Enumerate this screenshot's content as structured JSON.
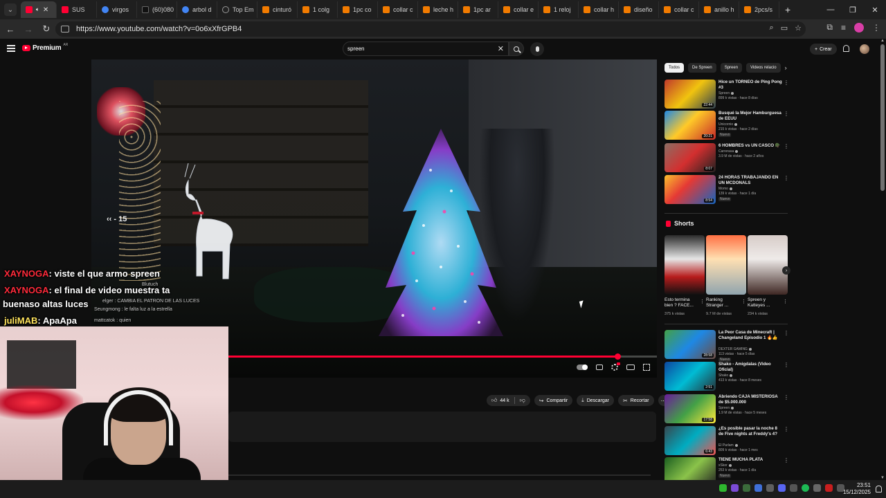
{
  "browser": {
    "tabs": [
      {
        "label": "",
        "favicon": "youtube",
        "active": true,
        "audio_icon": "speaker-icon"
      },
      {
        "label": "SUS",
        "favicon": "youtube"
      },
      {
        "label": "virgos",
        "favicon": "google"
      },
      {
        "label": "(60)080",
        "favicon": "tiktok"
      },
      {
        "label": "arbol d",
        "favicon": "google"
      },
      {
        "label": "Top Em",
        "favicon": "chatgpt"
      },
      {
        "label": "cinturó",
        "favicon": "aliexpress"
      },
      {
        "label": "1 colg",
        "favicon": "aliexpress"
      },
      {
        "label": "1pc co",
        "favicon": "aliexpress"
      },
      {
        "label": "collar c",
        "favicon": "aliexpress"
      },
      {
        "label": "leche h",
        "favicon": "aliexpress"
      },
      {
        "label": "1pc ar",
        "favicon": "aliexpress"
      },
      {
        "label": "collar e",
        "favicon": "aliexpress"
      },
      {
        "label": "1 reloj",
        "favicon": "aliexpress"
      },
      {
        "label": "collar h",
        "favicon": "aliexpress"
      },
      {
        "label": "diseño",
        "favicon": "aliexpress"
      },
      {
        "label": "collar c",
        "favicon": "aliexpress"
      },
      {
        "label": "anillo h",
        "favicon": "aliexpress"
      },
      {
        "label": "2pcs/s",
        "favicon": "aliexpress"
      }
    ],
    "url": "https://www.youtube.com/watch?v=0o6xXfrGPB4",
    "window_controls": {
      "minimize": "—",
      "restore": "❐",
      "close": "✕"
    }
  },
  "youtube": {
    "logo_text": "Premium",
    "logo_sup": "AR",
    "search_value": "spreen",
    "create_label": "Crear",
    "accent": "#ff0033"
  },
  "player": {
    "seek_hint": "15",
    "progress": 0.908,
    "chat": [
      {
        "user": "XAYNOGA",
        "message": ": viste el que armo spreen",
        "user_color": "#ff2a3a"
      },
      {
        "user": "XAYNOGA",
        "message": ": el final de video muestra ta",
        "user_color": "#ff2a3a"
      },
      {
        "user": "",
        "message": "buenaso altas luces",
        "user_color": "#ff2a3a"
      },
      {
        "user": "juliMAB",
        "message": ": ApaApa",
        "user_color": "#ffe45c"
      }
    ],
    "small_chat": [
      {
        "text": "Blutuch"
      },
      {
        "text": "elger : CAMBIA EL PATRON DE LAS LUCES"
      },
      {
        "text": "Seungmong : le falta luz a la estrella"
      },
      {
        "text": "mattcatok : quien"
      }
    ]
  },
  "actions": {
    "likes": "44 k",
    "share": "Compartir",
    "download": "Descargar",
    "clip": "Recortar"
  },
  "sidebar": {
    "chips": [
      "Todos",
      "De Spreen",
      "Spreen",
      "Videos relacio"
    ],
    "recommended_top": [
      {
        "title": "Hice un TORNEO de Ping Pong #3",
        "channel": "Spreen",
        "meta": "899 k vistas · hace 8 días",
        "duration": "22:44",
        "badge": ""
      },
      {
        "title": "Busqué la Mejor Hamburguesa de EEUU",
        "channel": "Unicornio",
        "meta": "215 k vistas · hace 2 días",
        "duration": "20:21",
        "badge": "Nuevo"
      },
      {
        "title": "6 HOMBRES vs UN CASCO 🪖",
        "channel": "Carrerasa",
        "meta": "3.9 M de vistas · hace 2 años",
        "duration": "8:07",
        "badge": ""
      },
      {
        "title": "24 HORAS TRABAJANDO EN UN MCDONALS",
        "channel": "Momo",
        "meta": "139 k vistas · hace 1 día",
        "duration": "8:54",
        "badge": "Nuevo"
      }
    ],
    "shorts_label": "Shorts",
    "shorts": [
      {
        "title": "Esto termina bien ? FACE...",
        "views": "375 k vistas"
      },
      {
        "title": "Ranking Stranger ...",
        "views": "9.7 M de vistas"
      },
      {
        "title": "Spreen y Katteyes ...",
        "views": "234 k vistas"
      }
    ],
    "recommended_bottom": [
      {
        "title": "La Peor Casa de Minecraft | Changeland Episodio 1 🔥👍",
        "channel": "DEXTER GAMING",
        "meta": "113 vistas · hace 5 días",
        "duration": "28:58",
        "badge": "Nuevo"
      },
      {
        "title": "Shako - Amigdalas (Video Oficial)",
        "channel": "Shako",
        "meta": "413 k vistas · hace 8 meses",
        "duration": "2:51",
        "badge": ""
      },
      {
        "title": "Abriendo CAJA MISTERIOSA de $5.000.000",
        "channel": "Spreen",
        "meta": "1.9 M de vistas · hace 5 meses",
        "duration": "17:58",
        "badge": ""
      },
      {
        "title": "¿Es posible pasar la noche 8 de Five nights at Freddy's 4?",
        "channel": "El Parlam",
        "meta": "809 k vistas · hace 1 mes",
        "duration": "6:43",
        "badge": ""
      },
      {
        "title": "TIENE MUCHA PLATA",
        "channel": "xSkor",
        "meta": "253 k vistas · hace 1 día",
        "duration": "",
        "badge": "Nuevo"
      }
    ]
  },
  "taskbar": {
    "time": "23:51",
    "date": "15/12/2025"
  }
}
